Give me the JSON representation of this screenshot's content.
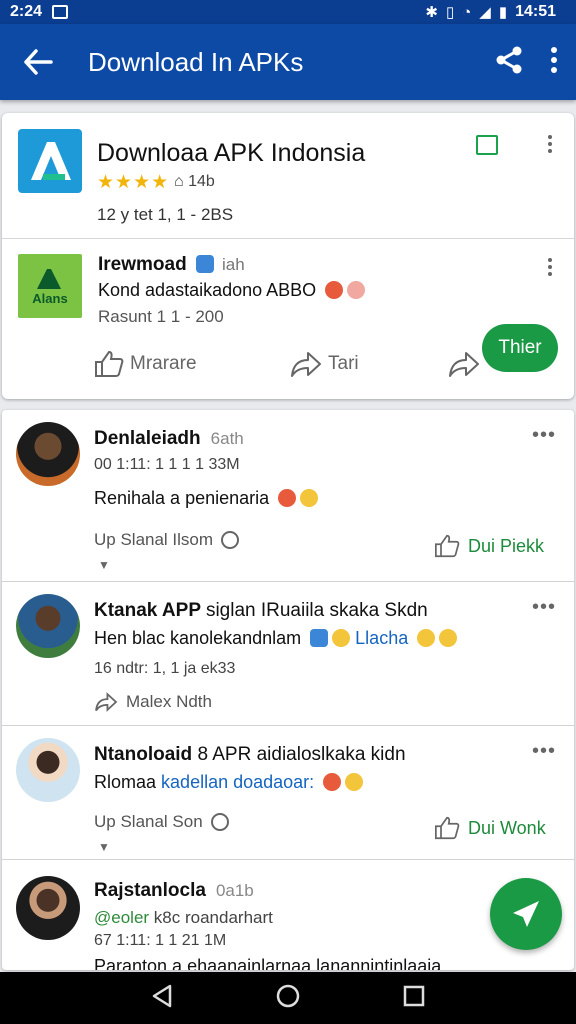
{
  "status_bar": {
    "time": "2:24",
    "right_time": "14:51"
  },
  "app_bar": {
    "title": "Download In APKs"
  },
  "app_card": {
    "name": "Downloaa APK Indonsia",
    "rating_stars": "★★★★",
    "stat": "14b",
    "meta": "12 y tet 1, 1 - 2BS"
  },
  "post_card": {
    "logo_text": "Alans",
    "title": "Irewmoad",
    "title_sub": "iah",
    "line": "Kond adastaikadono ABBO",
    "meta": "Rasunt 1 1 - 200",
    "actions": {
      "like": "Mrarare",
      "share": "Tari",
      "cta": "Thier"
    }
  },
  "feed": [
    {
      "name": "Denlaleiadh",
      "name_sub": "6ath",
      "meta": "00 1:11: 1 1 1 1 33M",
      "text": "Renihala a penienaria",
      "footer_left": "Up Slanal Ilsom",
      "footer_right": "Dui Piekk"
    },
    {
      "name": "Ktanak APP",
      "name_rest": "siglan IRuaiila skaka Skdn",
      "text_a": "Hen blac kanolekandnlam",
      "text_b": "Llacha",
      "meta": "16 ndtr: 1, 1 ja ek33",
      "footer_left": "Malex Ndth"
    },
    {
      "name": "Ntanoloaid",
      "name_rest": "8 APR aidialoslkaka kidn",
      "text_a": "Rlomaa",
      "text_b": "kadellan doadaoar:",
      "footer_left": "Up Slanal Son",
      "footer_right": "Dui Wonk"
    },
    {
      "name": "Rajstanlocla",
      "name_sub": "0a1b",
      "sub_line_a": "@eoler",
      "sub_line_b": "k8c roandarhart",
      "meta": "67 1:11: 1 1 21 1M",
      "text": "Paranton a ehaanainlarnaa lanannintinlaaia"
    }
  ]
}
